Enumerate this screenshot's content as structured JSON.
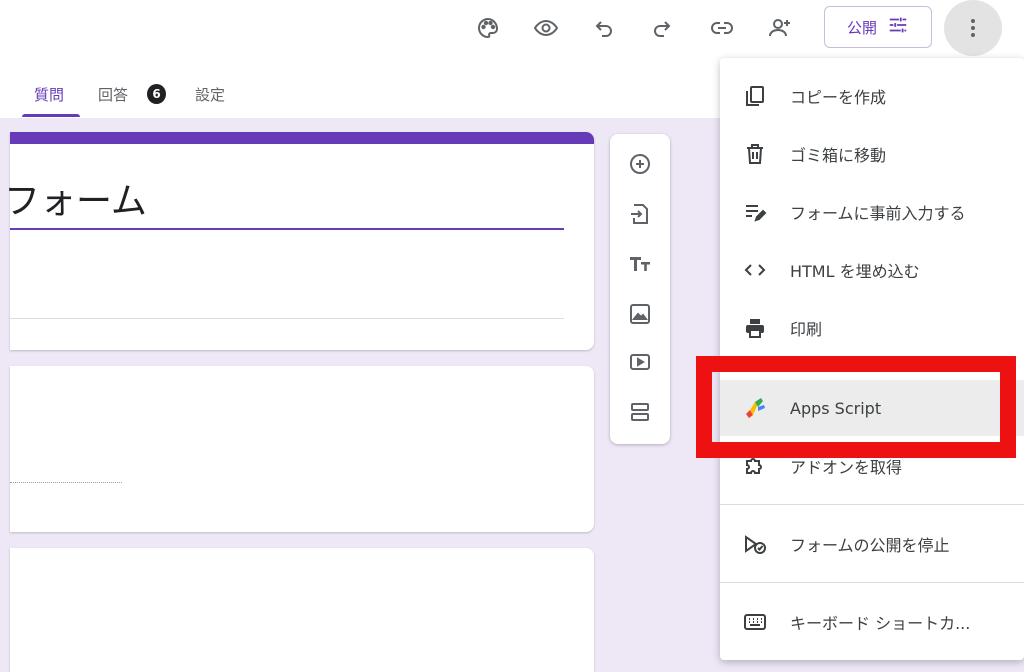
{
  "toolbar": {
    "icons": [
      "palette-icon",
      "eye-icon",
      "undo-icon",
      "redo-icon",
      "link-icon",
      "add-person-icon"
    ],
    "publish_label": "公開",
    "more_icon": "more-vert-icon"
  },
  "tabs": {
    "questions": "質問",
    "responses": "回答",
    "responses_count": "6",
    "settings": "設定"
  },
  "form": {
    "title": "フォーム"
  },
  "sidebar": {
    "icons": [
      "add-circle-icon",
      "import-icon",
      "title-icon",
      "image-icon",
      "video-icon",
      "section-icon"
    ]
  },
  "menu": {
    "items": [
      {
        "label": "コピーを作成",
        "icon": "copy-icon"
      },
      {
        "label": "ゴミ箱に移動",
        "icon": "trash-icon"
      },
      {
        "label": "フォームに事前入力する",
        "icon": "prefill-icon"
      },
      {
        "label": "HTML を埋め込む",
        "icon": "code-icon"
      },
      {
        "label": "印刷",
        "icon": "print-icon"
      },
      {
        "label": "Apps Script",
        "icon": "apps-script-icon"
      },
      {
        "label": "アドオンを取得",
        "icon": "addon-icon"
      },
      {
        "label": "フォームの公開を停止",
        "icon": "unpublish-icon"
      },
      {
        "label": "キーボード ショートカ...",
        "icon": "keyboard-icon"
      }
    ]
  },
  "colors": {
    "accent": "#673ab7",
    "canvas_bg": "#ede7f6",
    "highlight_box": "#ee1111"
  }
}
